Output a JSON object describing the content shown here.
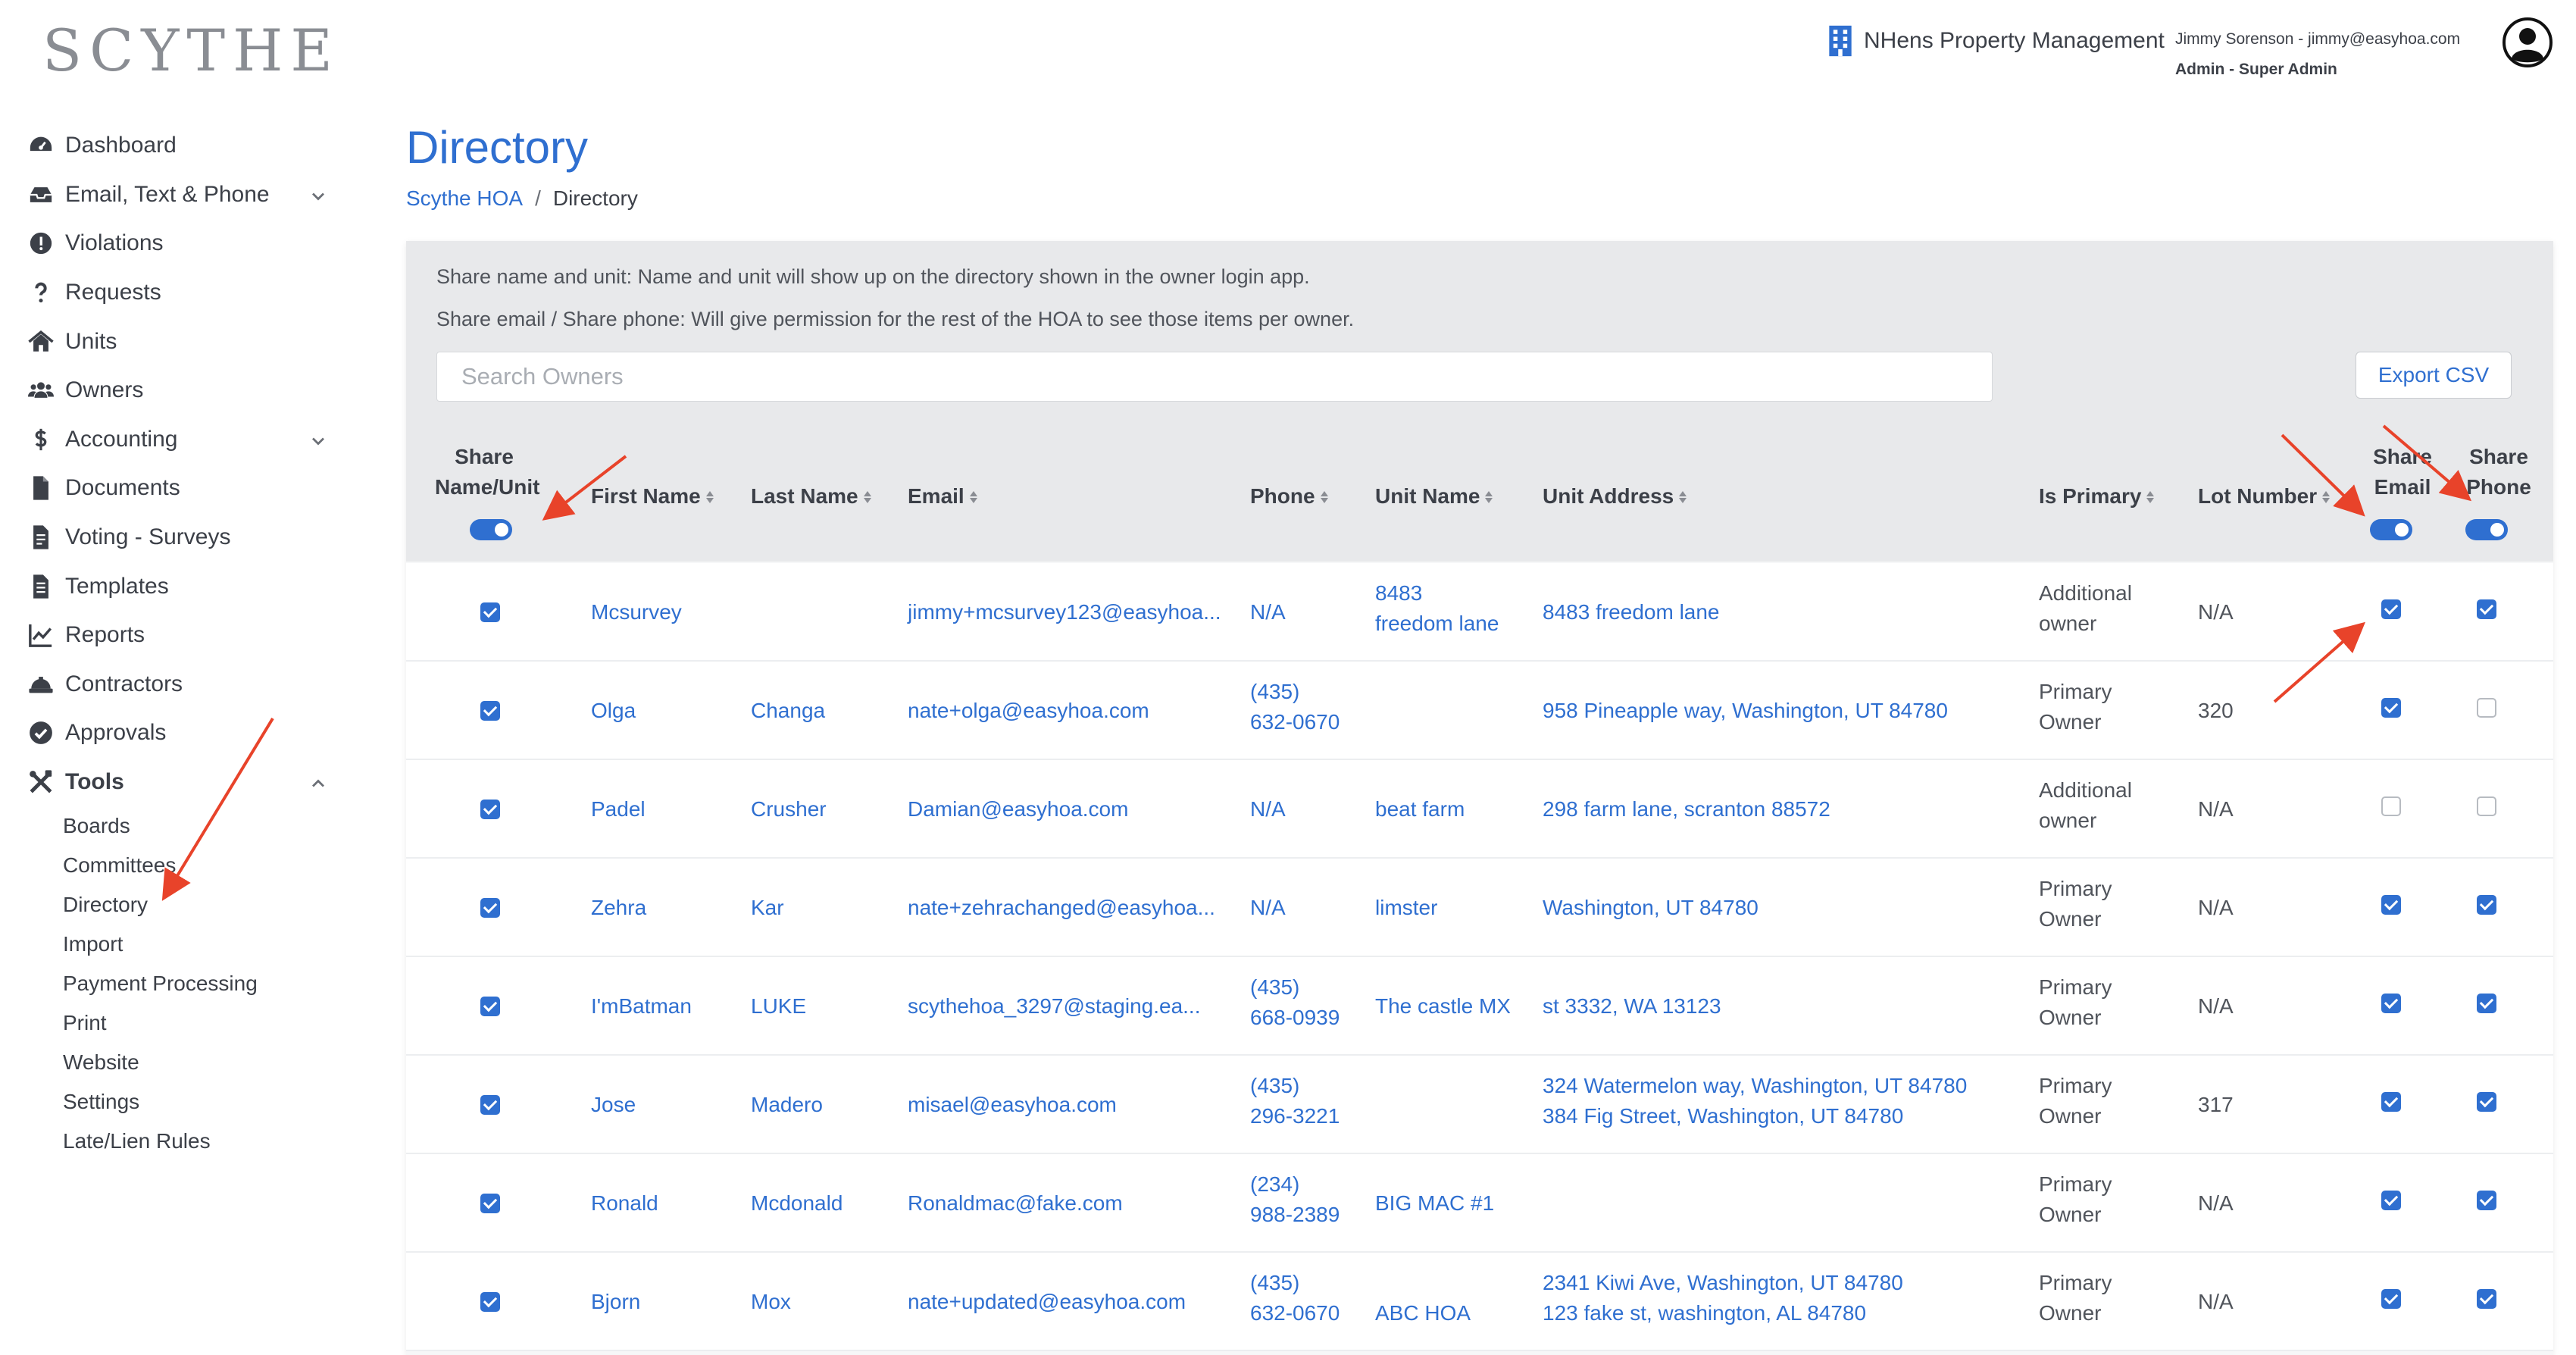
{
  "logo": "SCYTHE",
  "header": {
    "org_icon": "building-icon",
    "org_name": "NHens Property Management",
    "user_line": "Jimmy Sorenson - jimmy@easyhoa.com",
    "role_line": "Admin - Super Admin",
    "avatar_icon": "user-avatar-icon"
  },
  "sidebar": {
    "items": [
      {
        "label": "Dashboard",
        "icon": "dashboard-icon"
      },
      {
        "label": "Email, Text & Phone",
        "icon": "inbox-icon",
        "chevron": "down"
      },
      {
        "label": "Violations",
        "icon": "alert-icon"
      },
      {
        "label": "Requests",
        "icon": "question-icon"
      },
      {
        "label": "Units",
        "icon": "home-icon"
      },
      {
        "label": "Owners",
        "icon": "users-icon"
      },
      {
        "label": "Accounting",
        "icon": "dollar-icon",
        "chevron": "down"
      },
      {
        "label": "Documents",
        "icon": "document-icon"
      },
      {
        "label": "Voting - Surveys",
        "icon": "ballot-icon"
      },
      {
        "label": "Templates",
        "icon": "template-icon"
      },
      {
        "label": "Reports",
        "icon": "chart-icon"
      },
      {
        "label": "Contractors",
        "icon": "hardhat-icon"
      },
      {
        "label": "Approvals",
        "icon": "check-circle-icon"
      },
      {
        "label": "Tools",
        "icon": "tools-icon",
        "chevron": "up"
      }
    ],
    "tools_sub": [
      "Boards",
      "Committees",
      "Directory",
      "Import",
      "Payment Processing",
      "Print",
      "Website",
      "Settings",
      "Late/Lien Rules"
    ]
  },
  "page": {
    "title": "Directory",
    "breadcrumb": {
      "parent": "Scythe HOA",
      "separator": "/",
      "current": "Directory"
    }
  },
  "info": {
    "line1": "Share name and unit: Name and unit will show up on the directory shown in the owner login app.",
    "line2": "Share email / Share phone: Will give permission for the rest of the HOA to see those items per owner."
  },
  "search": {
    "placeholder": "Search Owners",
    "value": ""
  },
  "export_label": "Export CSV",
  "columns": {
    "share_name_unit_1": "Share",
    "share_name_unit_2": "Name/Unit",
    "first_name": "First Name",
    "last_name": "Last Name",
    "email": "Email",
    "phone": "Phone",
    "unit_name": "Unit Name",
    "unit_address": "Unit Address",
    "is_primary": "Is Primary",
    "lot_number": "Lot Number",
    "share_email_1": "Share",
    "share_email_2": "Email",
    "share_phone_1": "Share",
    "share_phone_2": "Phone"
  },
  "rows": [
    {
      "share_name": true,
      "first": "Mcsurvey",
      "last": "",
      "email": "jimmy+mcsurvey123@easyhoa...",
      "phone": "N/A",
      "phone2": "",
      "unit1": "8483",
      "unit2": "freedom lane",
      "addr1": "8483 freedom lane",
      "addr2": "",
      "primary1": "Additional",
      "primary2": "owner",
      "lot": "N/A",
      "share_email": true,
      "share_phone": true
    },
    {
      "share_name": true,
      "first": "Olga",
      "last": "Changa",
      "email": "nate+olga@easyhoa.com",
      "phone": "(435)",
      "phone2": "632-0670",
      "unit1": "",
      "unit2": "",
      "addr1": "958 Pineapple way, Washington, UT 84780",
      "addr2": "",
      "primary1": "Primary",
      "primary2": "Owner",
      "lot": "320",
      "share_email": true,
      "share_phone": false
    },
    {
      "share_name": true,
      "first": "Padel",
      "last": "Crusher",
      "email": "Damian@easyhoa.com",
      "phone": "N/A",
      "phone2": "",
      "unit1": "beat farm",
      "unit2": "",
      "addr1": "298 farm lane, scranton 88572",
      "addr2": "",
      "primary1": "Additional",
      "primary2": "owner",
      "lot": "N/A",
      "share_email": false,
      "share_phone": false
    },
    {
      "share_name": true,
      "first": "Zehra",
      "last": "Kar",
      "email": "nate+zehrachanged@easyhoa...",
      "phone": "N/A",
      "phone2": "",
      "unit1": "limster",
      "unit2": "",
      "addr1": "Washington, UT 84780",
      "addr2": "",
      "primary1": "Primary",
      "primary2": "Owner",
      "lot": "N/A",
      "share_email": true,
      "share_phone": true
    },
    {
      "share_name": true,
      "first": "I'mBatman",
      "last": "LUKE",
      "email": "scythehoa_3297@staging.ea...",
      "phone": "(435)",
      "phone2": "668-0939",
      "unit1": "The castle MX",
      "unit2": "",
      "addr1": "st 3332, WA 13123",
      "addr2": "",
      "primary1": "Primary",
      "primary2": "Owner",
      "lot": "N/A",
      "share_email": true,
      "share_phone": true
    },
    {
      "share_name": true,
      "first": "Jose",
      "last": "Madero",
      "email": "misael@easyhoa.com",
      "phone": "(435)",
      "phone2": "296-3221",
      "unit1": "",
      "unit2": "",
      "addr1": "324 Watermelon way, Washington, UT 84780",
      "addr2": "384 Fig Street, Washington, UT 84780",
      "primary1": "Primary",
      "primary2": "Owner",
      "lot": "317",
      "share_email": true,
      "share_phone": true
    },
    {
      "share_name": true,
      "first": "Ronald",
      "last": "Mcdonald",
      "email": "Ronaldmac@fake.com",
      "phone": "(234)",
      "phone2": "988-2389",
      "unit1": "BIG MAC #1",
      "unit2": "",
      "addr1": "",
      "addr2": "",
      "primary1": "Primary",
      "primary2": "Owner",
      "lot": "N/A",
      "share_email": true,
      "share_phone": true
    },
    {
      "share_name": true,
      "first": "Bjorn",
      "last": "Mox",
      "email": "nate+updated@easyhoa.com",
      "phone": "(435)",
      "phone2": "632-0670",
      "unit1": "ABC HOA",
      "unit2": "",
      "addr1": "2341 Kiwi Ave, Washington, UT 84780",
      "addr2": "123 fake st, washington, AL 84780",
      "primary1": "Primary",
      "primary2": "Owner",
      "lot": "N/A",
      "share_email": true,
      "share_phone": true
    }
  ],
  "colors": {
    "accent": "#2f6fd0",
    "annotation_arrow": "#e8432a",
    "panel": "#e8e9eb"
  }
}
